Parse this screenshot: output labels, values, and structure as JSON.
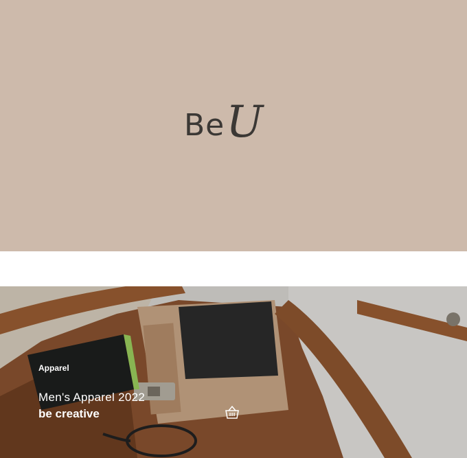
{
  "hero": {
    "logo_text_sans": "Be",
    "logo_text_script": "U",
    "background_color": "#cdbaab"
  },
  "banner": {
    "category": "Apparel",
    "title": "Men's Apparel 2022",
    "subtitle": "be creative",
    "cart_icon": "basket-icon"
  }
}
